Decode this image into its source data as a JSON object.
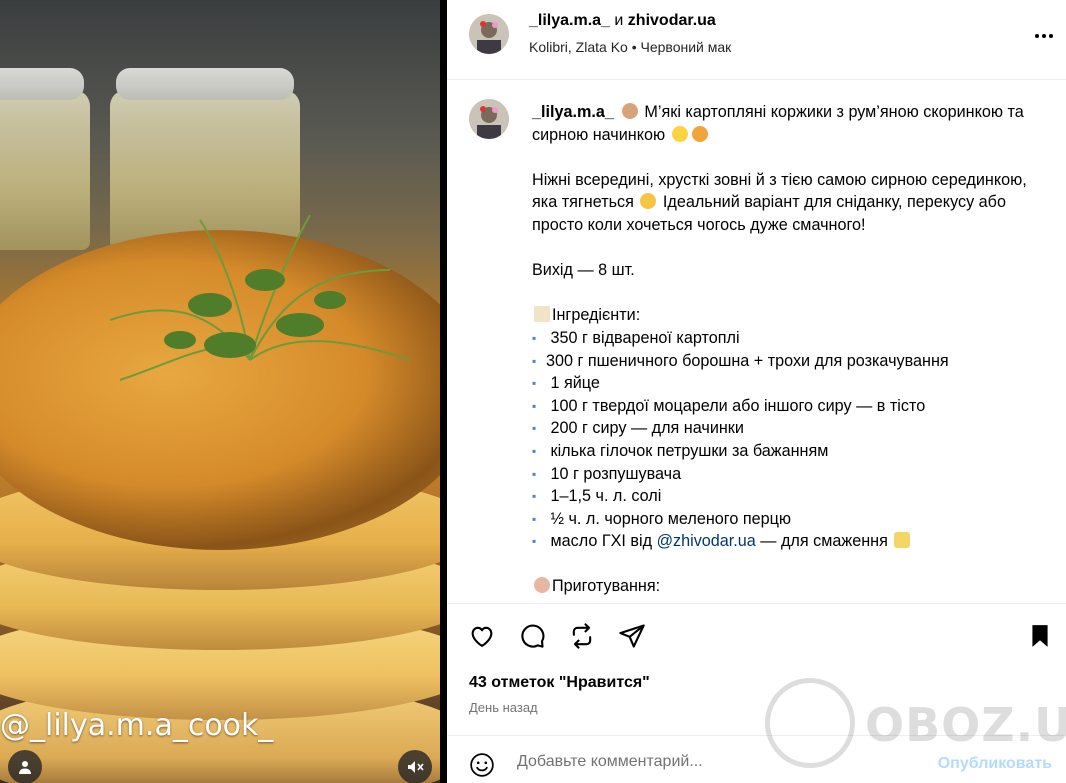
{
  "media": {
    "watermark_text": "@_lilya.m.a_cook_"
  },
  "post": {
    "author1": "_lilya.m.a_",
    "joiner": "и",
    "author2": "zhivodar.ua",
    "music": "Kolibri, Zlata Ko",
    "sep": "•",
    "song": "Червоний мак"
  },
  "caption": {
    "username": "_lilya.m.a_",
    "title": "М’які картопляні коржики з рум’яною скоринкою та сирною начинкою",
    "intro": "Ніжні всередині, хрусткі зовні й з тією самою сирною серединкою, яка тягнеться",
    "intro2": "Ідеальний варіант для сніданку, перекусу або просто коли хочеться чогось дуже смачного!",
    "yield": "Вихід — 8 шт.",
    "ingredients_title": "Інгредієнти:",
    "ingredients": [
      "350 г відвареної картоплі",
      "300 г пшеничного борошна + трохи для розкачування",
      "1 яйце",
      "100 г твердої моцарели або іншого сиру — в тісто",
      "200 г сиру — для начинки",
      "кілька гілочок петрушки за бажанням",
      "10 г розпушувача",
      "1–1,5 ч. л. солі",
      "½ ч. л. чорного меленого перцю"
    ],
    "last_ingredient_prefix": "масло ГХІ від",
    "last_ingredient_link": "@zhivodar.ua",
    "last_ingredient_suffix": "— для смаження",
    "method_title": "Приготування:"
  },
  "engagement": {
    "likes": "43 отметок \"Нравится\"",
    "date": "День назад"
  },
  "comment": {
    "placeholder": "Добавьте комментарий...",
    "publish": "Опубликовать"
  },
  "watermark": {
    "site": "OBOZ.UA"
  },
  "colors": {
    "link": "#00376b",
    "publish_disabled": "#b3dbff",
    "bullet": "#4a7fdc"
  }
}
